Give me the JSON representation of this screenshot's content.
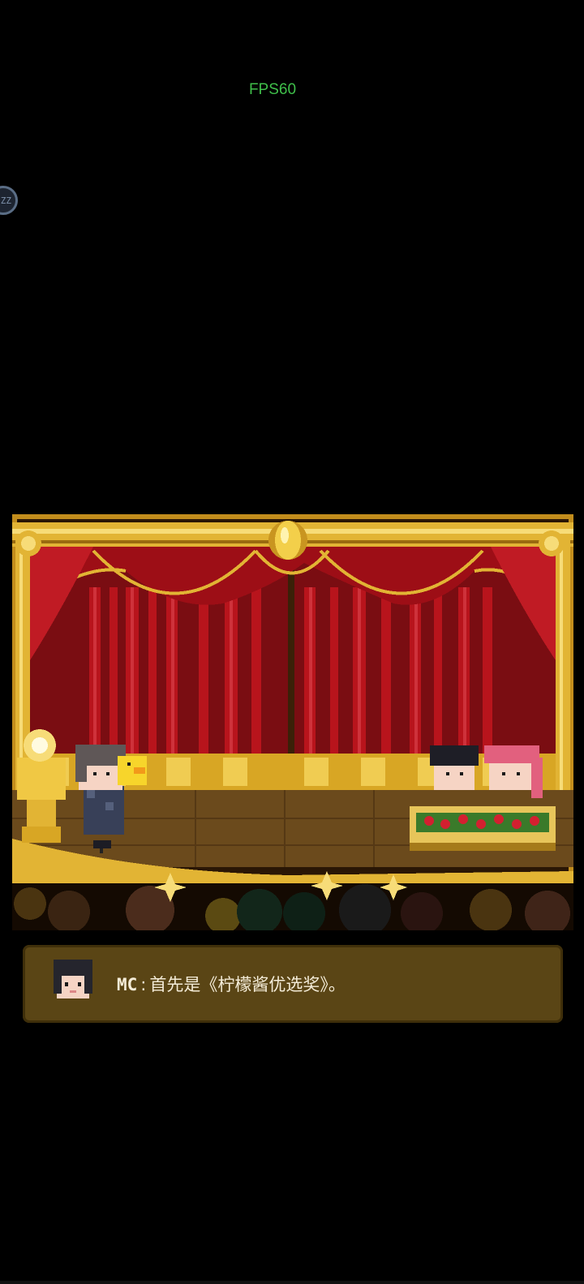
{
  "hud": {
    "fps_text": "FPS60",
    "floating_button_label": "ZZ"
  },
  "dialog": {
    "speaker": "MC",
    "separator": ":",
    "text": "首先是《柠檬酱优选奖》。"
  },
  "colors": {
    "fps": "#3fbf4a",
    "curtain": "#a3131b",
    "gold": "#e2b434",
    "dialog_bg": "#5a4515"
  }
}
